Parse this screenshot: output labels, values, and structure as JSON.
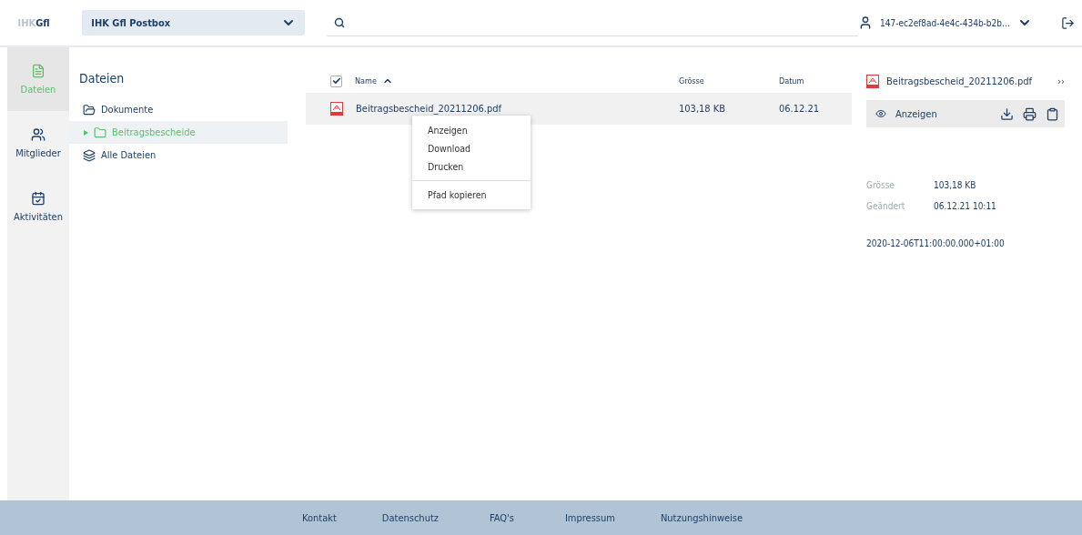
{
  "header": {
    "logo": {
      "part_1": "IHK",
      "part_2": "Gfl"
    },
    "postbox_select": "IHK Gfl Postbox",
    "user": "147-ec2ef8ad-4e4c-434b-b2b…"
  },
  "nav": [
    {
      "label": "Dateien",
      "kind": "file",
      "selected": true
    },
    {
      "label": "Mitglieder",
      "kind": "users",
      "selected": false
    },
    {
      "label": "Aktivitäten",
      "kind": "calendar",
      "selected": false
    }
  ],
  "tree": {
    "title": "Dateien",
    "items": [
      {
        "label": "Dokumente",
        "kind": "folder-open",
        "selected": false,
        "children": [
          {
            "label": "Beitragsbescheide",
            "kind": "folder",
            "selected": true
          }
        ]
      },
      {
        "label": "Alle Dateien",
        "kind": "layers",
        "selected": false
      }
    ]
  },
  "table": {
    "select_all_checked": true,
    "columns": [
      {
        "label": "Name",
        "sorted": true
      },
      {
        "label": "Grösse",
        "sorted": false
      },
      {
        "label": "Datum",
        "sorted": false
      }
    ],
    "rows": [
      {
        "name": "Beitragsbescheid_20211206.pdf",
        "size": "103,18 KB",
        "date": "06.12.21",
        "selected": true
      }
    ]
  },
  "context_menu": {
    "groups": [
      [
        "Anzeigen",
        "Download",
        "Drucken"
      ],
      [
        "Pfad kopieren"
      ]
    ]
  },
  "details": {
    "file_name": "Beitragsbescheid_20211206.pdf",
    "collapse": "››",
    "view_action": "Anzeigen",
    "properties": [
      {
        "label": "Grösse",
        "value": "103,18 KB"
      },
      {
        "label": "Geändert",
        "value": "06.12.21 10:11"
      }
    ],
    "timestamp": "2020-12-06T11:00:00.000+01:00"
  },
  "footer": [
    "Kontakt",
    "Datenschutz",
    "FAQ's",
    "Impressum",
    "Nutzungshinweise"
  ]
}
